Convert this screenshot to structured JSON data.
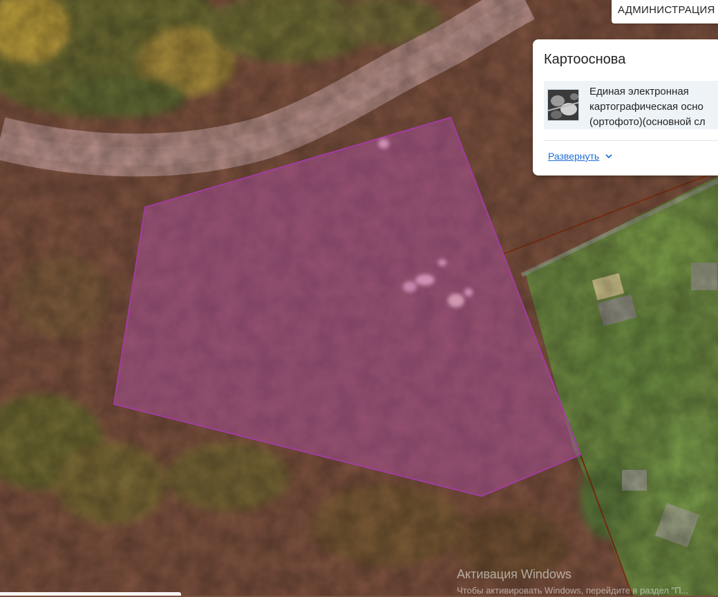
{
  "map": {
    "theme": "orthophoto",
    "parcel_fill_color": "#b14fa8",
    "parcel_border_color": "#a23ca0",
    "boundary_line_color": "#8a3414",
    "road_color": "#b58c86"
  },
  "admin_label": {
    "text": "АДМИНИСТРАЦИЯ"
  },
  "layers_panel": {
    "title": "Картооснова",
    "layer": {
      "thumb_icon": "orthophoto-thumbnail-icon",
      "name_lines": [
        "Единая электронная",
        "картографическая осно",
        "(ортофото)(основной сл"
      ]
    },
    "expand_label": "Развернуть",
    "expand_icon": "chevron-down-icon"
  },
  "watermark": {
    "title": "Активация Windows",
    "subtitle": "Чтобы активировать Windows, перейдите в раздел \"П..."
  }
}
